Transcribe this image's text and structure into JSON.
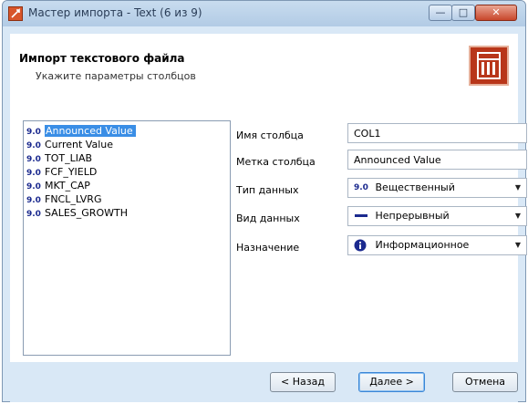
{
  "window": {
    "title": "Мастер импорта - Text (6 из 9)",
    "minimize_label": "—",
    "maximize_label": "□",
    "close_label": "✕"
  },
  "header": {
    "title": "Импорт текстового файла",
    "subtitle": "Укажите параметры столбцов"
  },
  "columns": [
    {
      "type_icon": "9.0",
      "label": "Announced Value",
      "selected": true
    },
    {
      "type_icon": "9.0",
      "label": "Current Value",
      "selected": false
    },
    {
      "type_icon": "9.0",
      "label": "TOT_LIAB",
      "selected": false
    },
    {
      "type_icon": "9.0",
      "label": "FCF_YIELD",
      "selected": false
    },
    {
      "type_icon": "9.0",
      "label": "MKT_CAP",
      "selected": false
    },
    {
      "type_icon": "9.0",
      "label": "FNCL_LVRG",
      "selected": false
    },
    {
      "type_icon": "9.0",
      "label": "SALES_GROWTH",
      "selected": false
    }
  ],
  "properties": {
    "column_name_label": "Имя столбца",
    "column_name_value": "COL1",
    "column_label_label": "Метка столбца",
    "column_label_value": "Announced Value",
    "data_type_label": "Тип данных",
    "data_type_value": "Вещественный",
    "data_type_icon": "9.0",
    "data_kind_label": "Вид данных",
    "data_kind_value": "Непрерывный",
    "role_label": "Назначение",
    "role_value": "Информационное"
  },
  "footer": {
    "back_label": "< Назад",
    "next_label": "Далее >",
    "cancel_label": "Отмена"
  },
  "colors": {
    "accent": "#3a8ee6",
    "frame": "#d9e8f6",
    "logo": "#b8361a"
  }
}
